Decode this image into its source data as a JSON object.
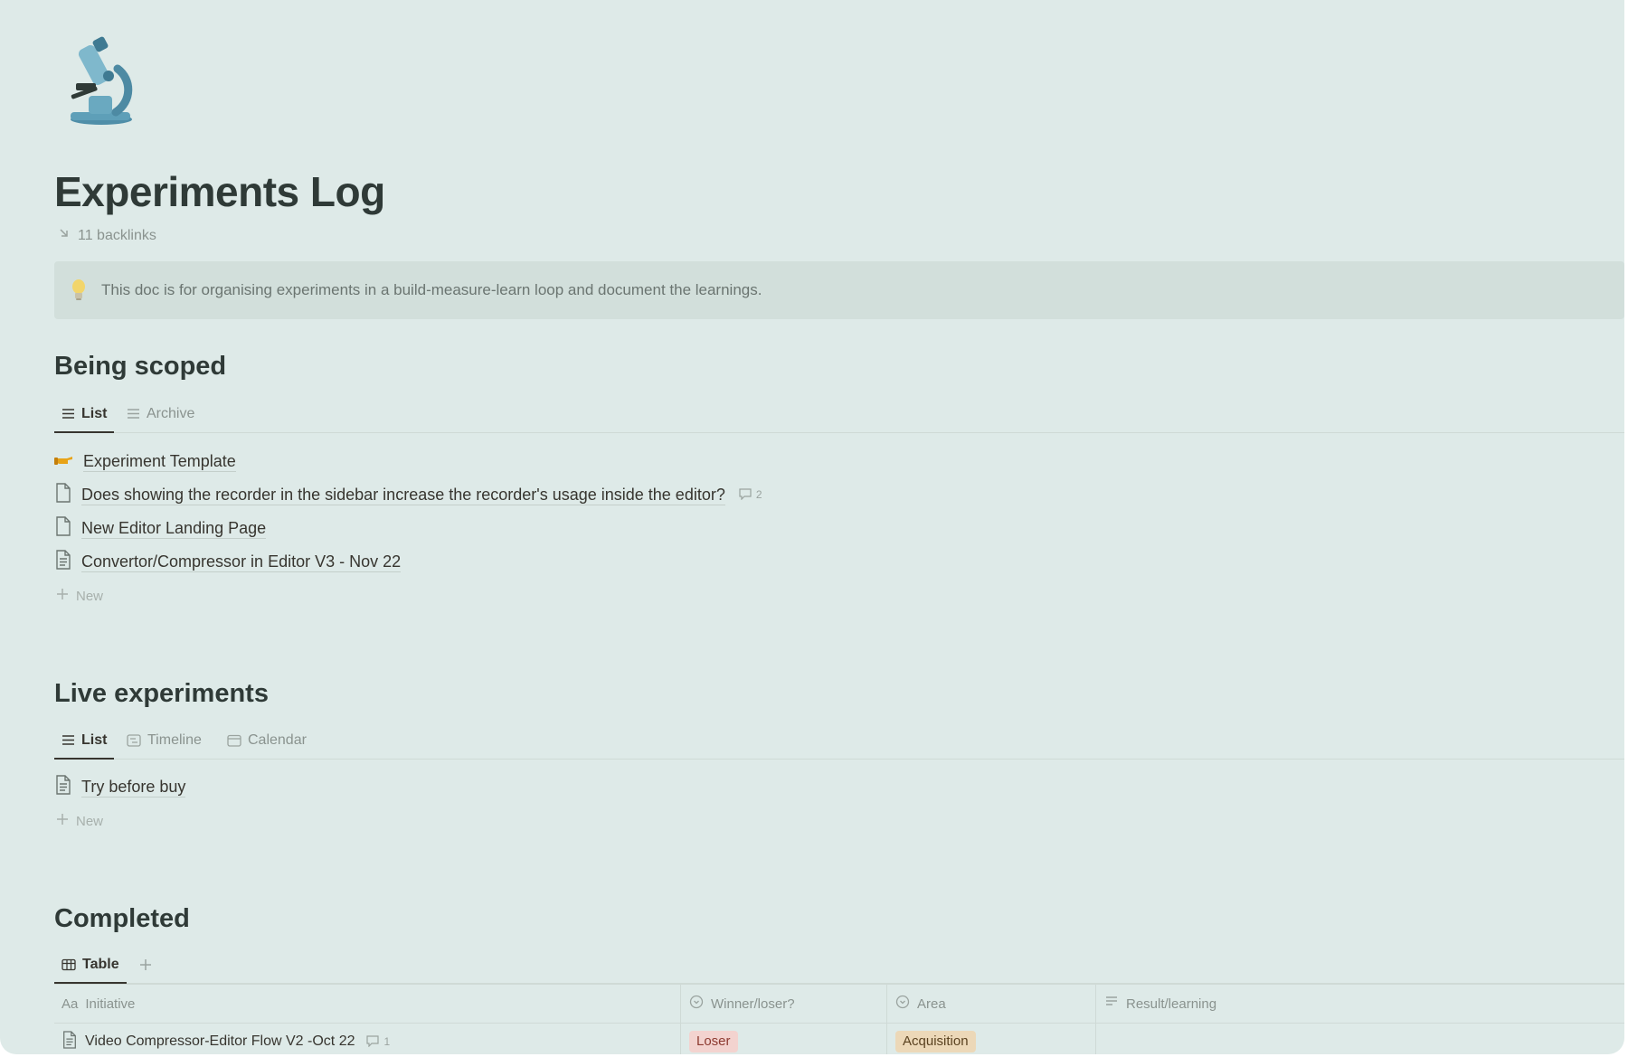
{
  "page": {
    "icon": "microscope-icon",
    "title": "Experiments Log",
    "backlinks": "11 backlinks"
  },
  "callout": {
    "icon": "lightbulb-icon",
    "text": "This doc is for organising experiments in a build-measure-learn loop and document the learnings."
  },
  "sections": {
    "being_scoped": {
      "heading": "Being scoped",
      "tabs": [
        {
          "label": "List",
          "icon": "list-icon",
          "active": true
        },
        {
          "label": "Archive",
          "icon": "list-icon",
          "active": false
        }
      ],
      "items": [
        {
          "icon": "pointing-hand-icon",
          "label": "Experiment Template"
        },
        {
          "icon": "page-icon",
          "label": "Does showing the recorder in the sidebar increase the recorder's usage inside the editor?",
          "comments": "2"
        },
        {
          "icon": "page-icon",
          "label": "New Editor Landing Page"
        },
        {
          "icon": "page-text-icon",
          "label": "Convertor/Compressor in Editor V3 - Nov 22"
        }
      ],
      "new_label": "New"
    },
    "live": {
      "heading": "Live experiments",
      "tabs": [
        {
          "label": "List",
          "icon": "list-icon",
          "active": true
        },
        {
          "label": "Timeline",
          "icon": "timeline-icon",
          "active": false
        },
        {
          "label": "Calendar",
          "icon": "calendar-icon",
          "active": false
        }
      ],
      "items": [
        {
          "icon": "page-text-icon",
          "label": "Try before buy"
        }
      ],
      "new_label": "New"
    },
    "completed": {
      "heading": "Completed",
      "tabs": [
        {
          "label": "Table",
          "icon": "table-icon",
          "active": true
        }
      ],
      "columns": [
        {
          "label": "Initiative",
          "prefix": "Aa",
          "icon": "text-property-icon"
        },
        {
          "label": "Winner/loser?",
          "icon": "select-property-icon"
        },
        {
          "label": "Area",
          "icon": "select-property-icon"
        },
        {
          "label": "Result/learning",
          "icon": "text-lines-icon"
        }
      ],
      "rows": [
        {
          "initiative": "Video Compressor-Editor Flow V2 -Oct 22",
          "comments": "1",
          "winner": "Loser",
          "area": "Acquisition",
          "result": ""
        }
      ]
    }
  },
  "colors": {
    "background": "#deeae8",
    "callout_bg": "#d2dfdb",
    "text": "#37352f",
    "muted": "#8a938f",
    "loser_tag_bg": "#f3d3cf",
    "loser_tag_fg": "#8d3a30",
    "acquisition_tag_bg": "#ecd8b8",
    "acquisition_tag_fg": "#5a4220"
  }
}
